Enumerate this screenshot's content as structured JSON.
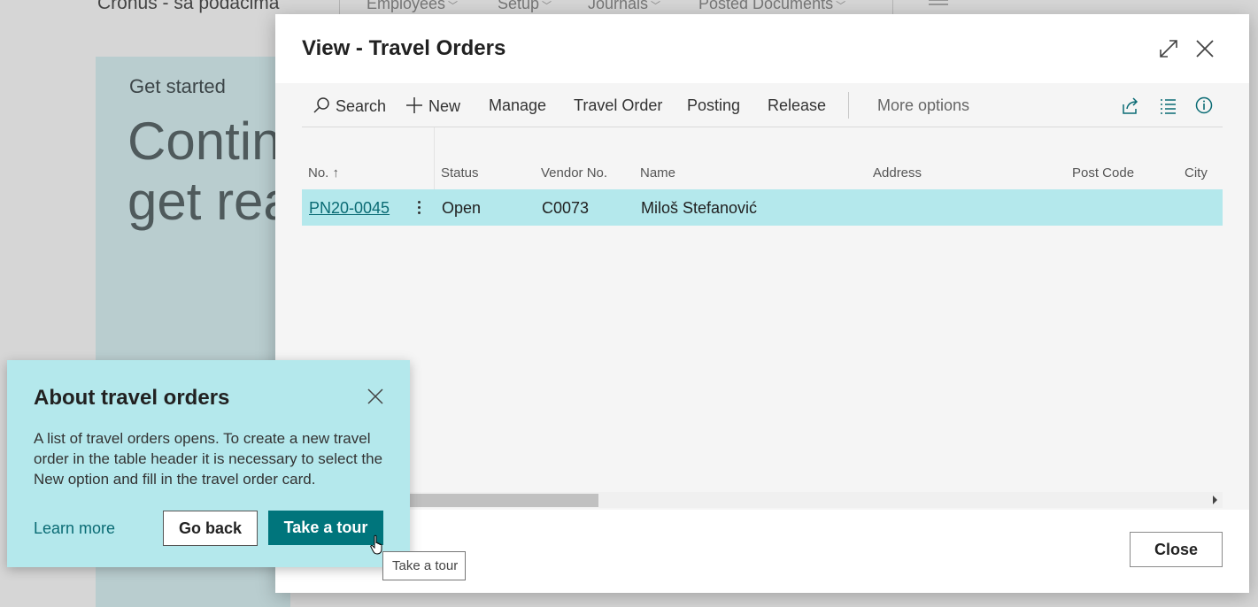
{
  "background": {
    "company_name": "Cronus - sa podacima",
    "nav": [
      "Employees",
      "Setup",
      "Journals",
      "Posted Documents"
    ],
    "card": {
      "label": "Get started",
      "headline_line1": "Contin",
      "headline_line2": "get rea"
    }
  },
  "dialog": {
    "title": "View - Travel Orders",
    "actions": {
      "search": "Search",
      "new": "New",
      "manage": "Manage",
      "travel_order": "Travel Order",
      "posting": "Posting",
      "release": "Release",
      "more_options": "More options"
    },
    "columns": {
      "no": "No. ↑",
      "status": "Status",
      "vendor_no": "Vendor No.",
      "name": "Name",
      "address": "Address",
      "post_code": "Post Code",
      "city": "City"
    },
    "rows": [
      {
        "no": "PN20-0045",
        "status": "Open",
        "vendor_no": "C0073",
        "name": "Miloš Stefanović",
        "address": "",
        "post_code": "",
        "city": ""
      }
    ],
    "close_label": "Close"
  },
  "teaching_tip": {
    "title": "About travel orders",
    "body": "A list of travel orders opens. To create a new travel order in the table header it is necessary to select the New option and fill in the travel order card.",
    "learn_more": "Learn more",
    "go_back": "Go back",
    "take_tour": "Take a tour",
    "tooltip": "Take a tour"
  },
  "colors": {
    "accent": "#00757c",
    "link": "#0a6b74",
    "selected_row": "#b4e8ec",
    "tip_background": "#b4e8ec"
  }
}
